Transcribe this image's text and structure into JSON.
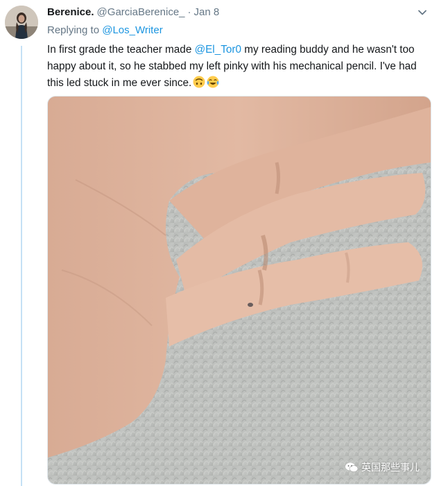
{
  "tweet": {
    "display_name": "Berenice.",
    "handle": "@GarciaBerenice_",
    "separator": "·",
    "date": "Jan 8",
    "replying_prefix": "Replying to",
    "replying_to": "@Los_Writer",
    "text_before_mention": "In first grade the teacher made ",
    "mention": "@El_Tor0",
    "text_after_mention": " my reading buddy and he wasn't too happy about it, so he stabbed my left pinky with his mechanical pencil. I've had this led stuck in me ever since.",
    "emojis": [
      "upside-down-face",
      "tears-of-joy"
    ]
  },
  "watermark": {
    "text": "英国那些事儿"
  },
  "colors": {
    "link": "#1b95e0",
    "secondary_text": "#657786",
    "primary_text": "#14171a",
    "thread_line": "#c4e0f5"
  }
}
